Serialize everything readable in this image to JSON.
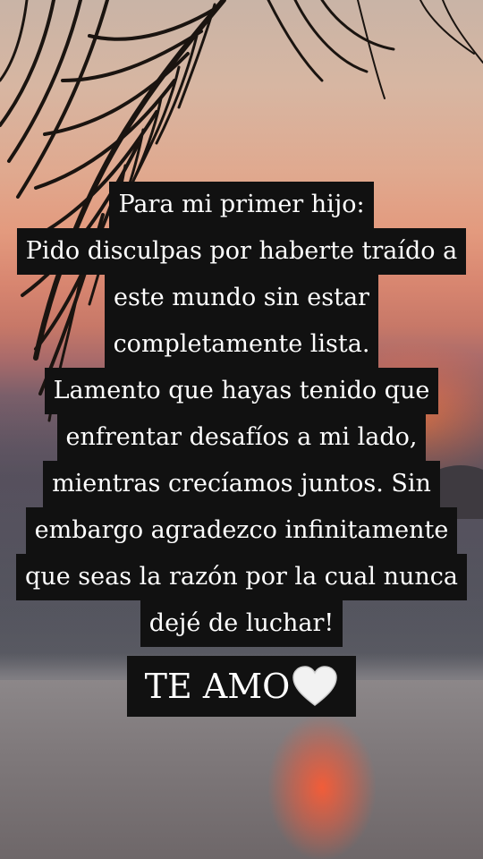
{
  "background": {
    "description_icon": "sunset-palm-icon",
    "colors": {
      "sky_top": "#c9b4a6",
      "sun": "#ff7a3c",
      "sea": "#7f797b",
      "caption_box": "#111111",
      "text": "#ffffff"
    }
  },
  "caption": {
    "lines": [
      "Para mi primer hijo:",
      "Pido disculpas por haberte traído a",
      "este mundo sin estar",
      "completamente lista.",
      "Lamento que hayas tenido que",
      "enfrentar desafíos a mi lado,",
      "mientras crecíamos juntos. Sin",
      "embargo agradezco infinitamente",
      "que seas la razón por la cual nunca",
      "dejé de luchar!"
    ],
    "closing": "TE AMO",
    "closing_icon": "white-heart-icon"
  }
}
